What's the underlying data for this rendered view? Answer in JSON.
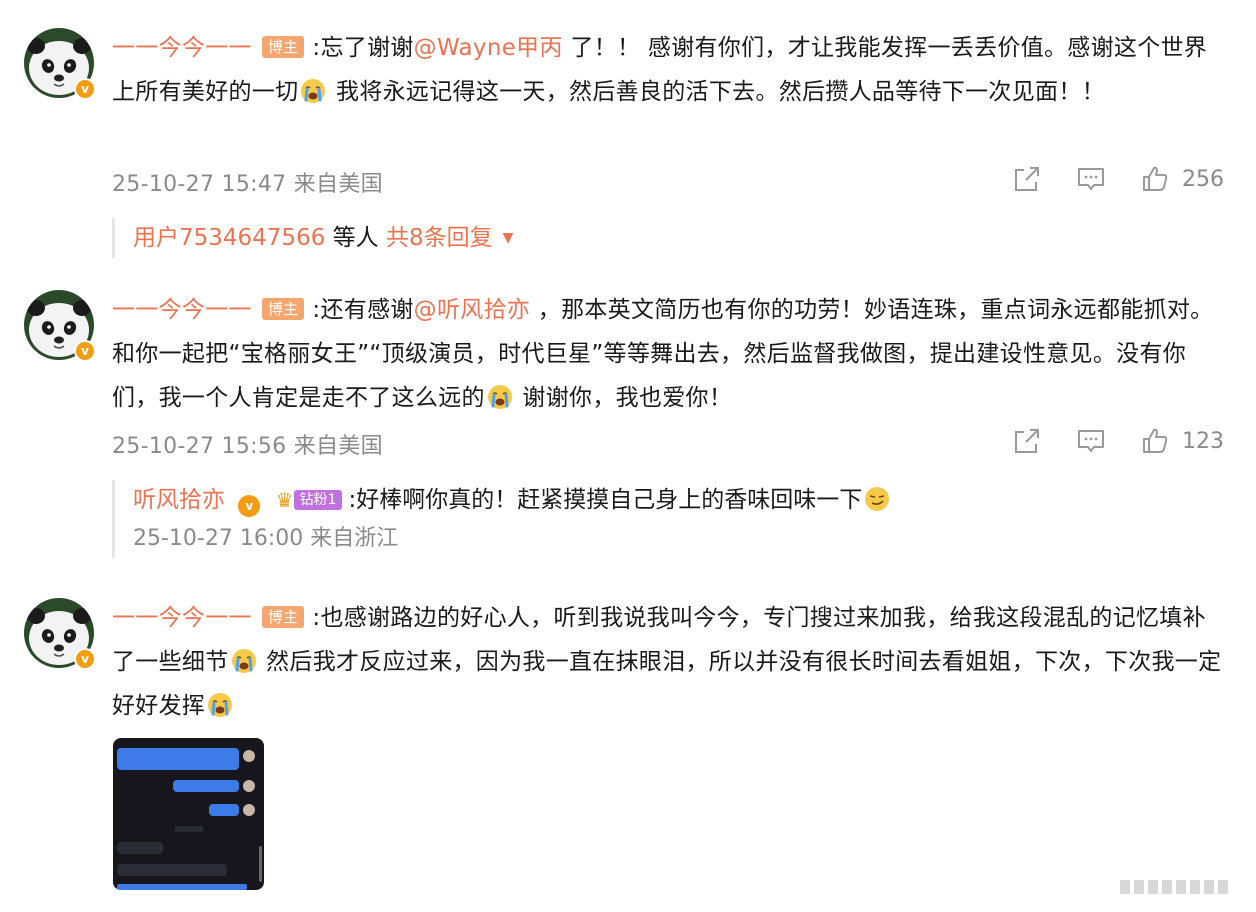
{
  "comments": [
    {
      "username": "一一今今一一",
      "tag": "博主",
      "text_a": ":忘了谢谢",
      "mention": "@Wayne甲丙",
      "text_b": " 了！！ 感谢有你们，才让我能发挥一丢丢价值。感谢这个世界上所有美好的一切",
      "text_c": " 我将永远记得这一天，然后善良的活下去。然后攒人品等待下一次见面！！",
      "meta": "25-10-27 15:47 来自美国",
      "likes": "256",
      "replies_users": "用户7534647566",
      "replies_and": " 等人 ",
      "replies_count": "共8条回复"
    },
    {
      "username": "一一今今一一",
      "tag": "博主",
      "text_a": ":还有感谢",
      "mention": "@听风拾亦",
      "text_b": " ，那本英文简历也有你的功劳！妙语连珠，重点词永远都能抓对。和你一起把“宝格丽女王”“顶级演员，时代巨星”等等舞出去，然后监督我做图，提出建设性意见。没有你们，我一个人肯定是走不了这么远的",
      "text_c": " 谢谢你，我也爱你！",
      "meta": "25-10-27 15:56 来自美国",
      "likes": "123",
      "reply": {
        "username": "听风拾亦",
        "fan_badge": "钻粉1",
        "text": ":好棒啊你真的！赶紧摸摸自己身上的香味回味一下",
        "meta": "25-10-27 16:00 来自浙江"
      }
    },
    {
      "username": "一一今今一一",
      "tag": "博主",
      "text_a": ":也感谢路边的好心人，听到我说我叫今今，专门搜过来加我，给我这段混乱的记忆填补了一些细节",
      "text_b": " 然后我才反应过来，因为我一直在抹眼泪，所以并没有很长时间去看姐姐，下次，下次我一定好好发挥"
    }
  ],
  "icons": {
    "share": "share-icon",
    "comment": "comment-icon",
    "like": "like-icon",
    "crying": "crying-emoji-icon",
    "smirk": "smirk-emoji-icon",
    "dropdown": "caret-down-icon"
  },
  "colors": {
    "accent": "#eb7350",
    "tag_bg": "#f5a56e",
    "meta_gray": "#8a8a8a",
    "fan_badge": "#c070e0"
  }
}
